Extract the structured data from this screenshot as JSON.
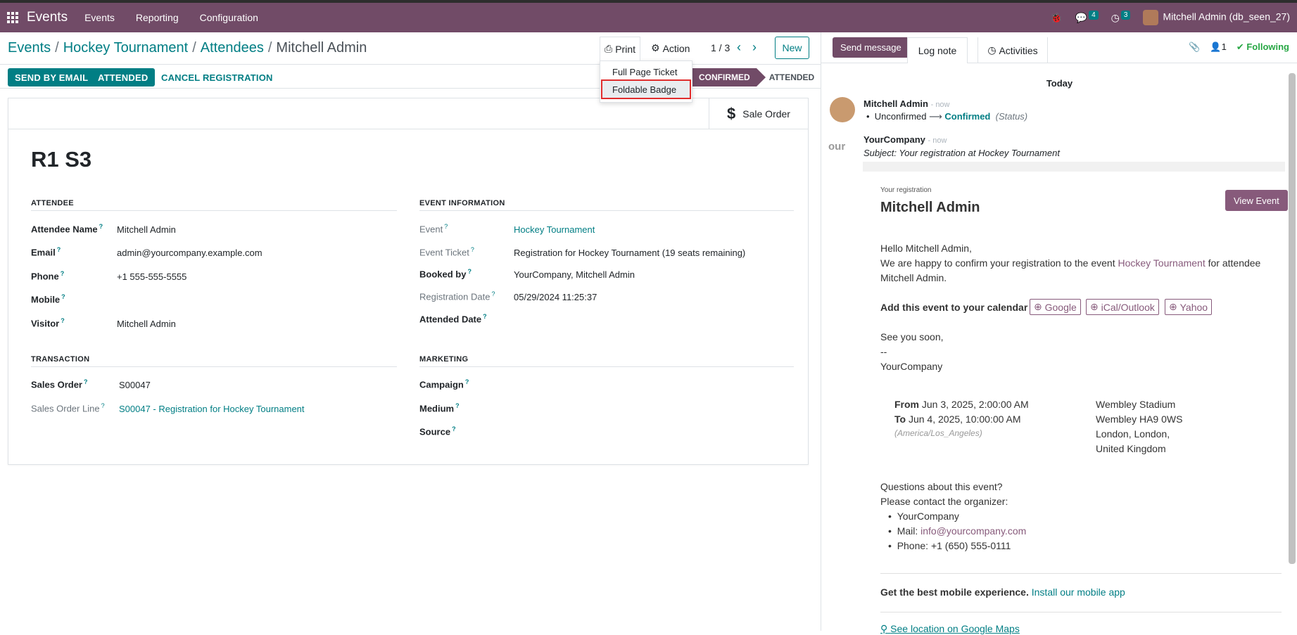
{
  "navbar": {
    "app": "Events",
    "menus": [
      "Events",
      "Reporting",
      "Configuration"
    ],
    "messages_count": "4",
    "activities_count": "3",
    "user": "Mitchell Admin (db_seen_27)"
  },
  "breadcrumb": [
    "Events",
    "Hockey Tournament",
    "Attendees",
    "Mitchell Admin"
  ],
  "toolbar": {
    "print": "Print",
    "action": "Action",
    "pager": "1 / 3",
    "new": "New"
  },
  "print_menu": [
    "Full Page Ticket",
    "Foldable Badge"
  ],
  "statusbar": {
    "send_email": "SEND BY EMAIL",
    "attended": "ATTENDED",
    "cancel": "CANCEL REGISTRATION",
    "stage_current": "CONFIRMED",
    "stage_next": "ATTENDED"
  },
  "smart_button": "Sale Order",
  "record_title": "R1 S3",
  "attendee": {
    "group": "ATTENDEE",
    "name_label": "Attendee Name",
    "name": "Mitchell Admin",
    "email_label": "Email",
    "email": "admin@yourcompany.example.com",
    "phone_label": "Phone",
    "phone": "+1 555-555-5555",
    "mobile_label": "Mobile",
    "visitor_label": "Visitor",
    "visitor": "Mitchell Admin"
  },
  "event_info": {
    "group": "EVENT INFORMATION",
    "event_label": "Event",
    "event": "Hockey Tournament",
    "ticket_label": "Event Ticket",
    "ticket": "Registration for Hockey Tournament (19 seats remaining)",
    "booked_label": "Booked by",
    "booked": "YourCompany, Mitchell Admin",
    "regdate_label": "Registration Date",
    "regdate": "05/29/2024 11:25:37",
    "attended_label": "Attended Date"
  },
  "transaction": {
    "group": "TRANSACTION",
    "so_label": "Sales Order",
    "so": "S00047",
    "sol_label": "Sales Order Line",
    "sol": "S00047 - Registration for Hockey Tournament"
  },
  "marketing": {
    "group": "MARKETING",
    "campaign": "Campaign",
    "medium": "Medium",
    "source": "Source"
  },
  "chatter": {
    "send_message": "Send message",
    "log_note": "Log note",
    "activities": "Activities",
    "followers": "1",
    "following": "Following",
    "today": "Today",
    "msg1_author": "Mitchell Admin",
    "msg1_time": "- now",
    "msg1_old": "Unconfirmed",
    "msg1_new": "Confirmed",
    "msg1_field": "(Status)",
    "msg2_author": "YourCompany",
    "msg2_time": "- now",
    "msg2_subject": "Subject: Your registration at Hockey Tournament",
    "partial": "our"
  },
  "mail": {
    "kicker": "Your registration",
    "name": "Mitchell Admin",
    "view_event": "View Event",
    "hello": "Hello Mitchell Admin,",
    "line1a": "We are happy to confirm your registration to the event ",
    "line1_event": "Hockey Tournament",
    "line1b": " for attendee",
    "line2": "Mitchell Admin.",
    "add_cal": "Add this event to your calendar",
    "cal": [
      "Google",
      "iCal/Outlook",
      "Yahoo"
    ],
    "see_you": "See you soon,",
    "dashes": "--",
    "company": "YourCompany",
    "from_label": "From",
    "from": "Jun 3, 2025, 2:00:00 AM",
    "to_label": "To",
    "to": "Jun 4, 2025, 10:00:00 AM",
    "tz": "(America/Los_Angeles)",
    "venue": [
      "Wembley Stadium",
      "Wembley HA9 0WS",
      "London, London,",
      "United Kingdom"
    ],
    "questions": "Questions about this event?",
    "contact": "Please contact the organizer:",
    "org": "YourCompany",
    "mail_label": "Mail: ",
    "mail": "info@yourcompany.com",
    "phone": "Phone: +1 (650) 555-0111",
    "mobile_a": "Get the best mobile experience.",
    "mobile_b": " Install our mobile app",
    "maps": "See location on Google Maps"
  }
}
